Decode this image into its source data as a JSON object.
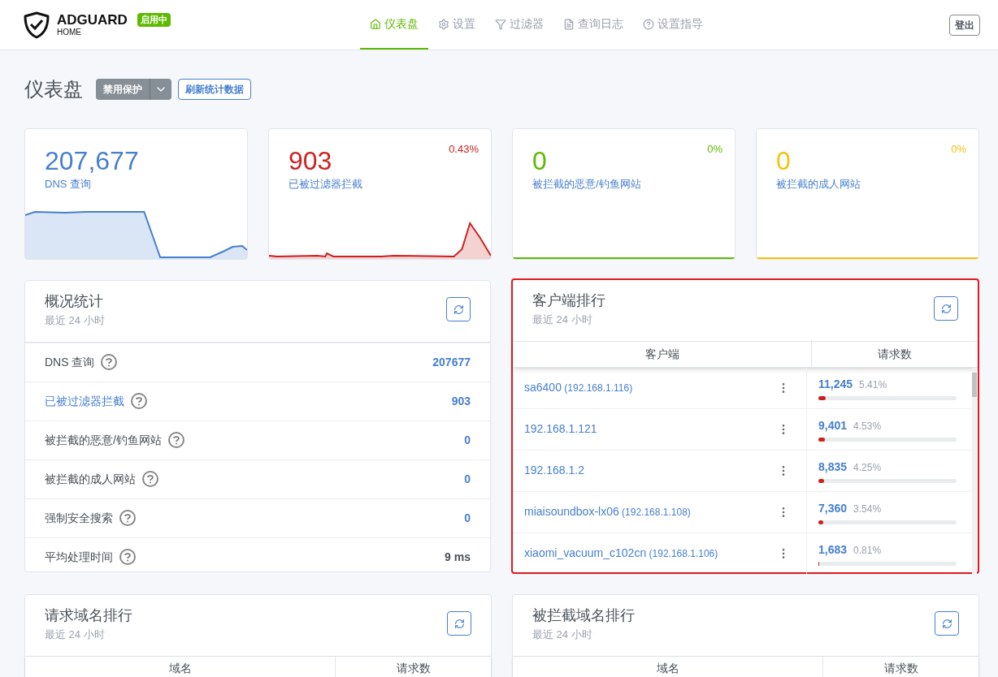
{
  "header": {
    "brand": "ADGUARD",
    "sub": "HOME",
    "status_badge": "启用中",
    "nav": [
      {
        "label": "仪表盘",
        "selected": true
      },
      {
        "label": "设置",
        "selected": false
      },
      {
        "label": "过滤器",
        "selected": false
      },
      {
        "label": "查询日志",
        "selected": false
      },
      {
        "label": "设置指导",
        "selected": false
      }
    ],
    "logout": "登出"
  },
  "page": {
    "title": "仪表盘",
    "disable_button": "禁用保护",
    "refresh_button": "刷新统计数据"
  },
  "stat_cards": [
    {
      "value": "207,677",
      "label": "DNS 查询",
      "color": "#467fcf"
    },
    {
      "value": "903",
      "label": "已被过滤器拦截",
      "percent": "0.43%",
      "color": "#cd201f"
    },
    {
      "value": "0",
      "label": "被拦截的恶意/钓鱼网站",
      "percent": "0%",
      "color": "#5eba00"
    },
    {
      "value": "0",
      "label": "被拦截的成人网站",
      "percent": "0%",
      "color": "#f1c40f"
    }
  ],
  "overview": {
    "title": "概况统计",
    "subtitle": "最近 24 小时",
    "rows": [
      {
        "label": "DNS 查询",
        "value": "207677",
        "link": false,
        "plain": false
      },
      {
        "label": "已被过滤器拦截",
        "value": "903",
        "link": true,
        "plain": false
      },
      {
        "label": "被拦截的恶意/钓鱼网站",
        "value": "0",
        "link": false,
        "plain": false
      },
      {
        "label": "被拦截的成人网站",
        "value": "0",
        "link": false,
        "plain": false
      },
      {
        "label": "强制安全搜索",
        "value": "0",
        "link": false,
        "plain": false
      },
      {
        "label": "平均处理时间",
        "value": "9 ms",
        "link": false,
        "plain": true
      }
    ]
  },
  "clients": {
    "title": "客户端排行",
    "subtitle": "最近 24 小时",
    "highlighted": true,
    "columns": [
      "客户端",
      "请求数"
    ],
    "rows": [
      {
        "name": "sa6400",
        "ip": "(192.168.1.116)",
        "count": "11,245",
        "percent": "5.41%",
        "level": 0.054
      },
      {
        "name": "192.168.1.121",
        "count": "9,401",
        "percent": "4.53%",
        "level": 0.045
      },
      {
        "name": "192.168.1.2",
        "count": "8,835",
        "percent": "4.25%",
        "level": 0.042
      },
      {
        "name": "miaisoundbox-lx06",
        "ip": "(192.168.1.108)",
        "count": "7,360",
        "percent": "3.54%",
        "level": 0.035
      },
      {
        "name": "xiaomi_vacuum_c102cn",
        "ip": "(192.168.1.106)",
        "count": "1,683",
        "percent": "0.81%",
        "level": 0.008
      }
    ]
  },
  "top_domains": {
    "title": "请求域名排行",
    "subtitle": "最近 24 小时",
    "columns": [
      "域名",
      "请求数"
    ]
  },
  "blocked_domains": {
    "title": "被拦截域名排行",
    "subtitle": "最近 24 小时",
    "columns": [
      "域名",
      "请求数"
    ]
  }
}
